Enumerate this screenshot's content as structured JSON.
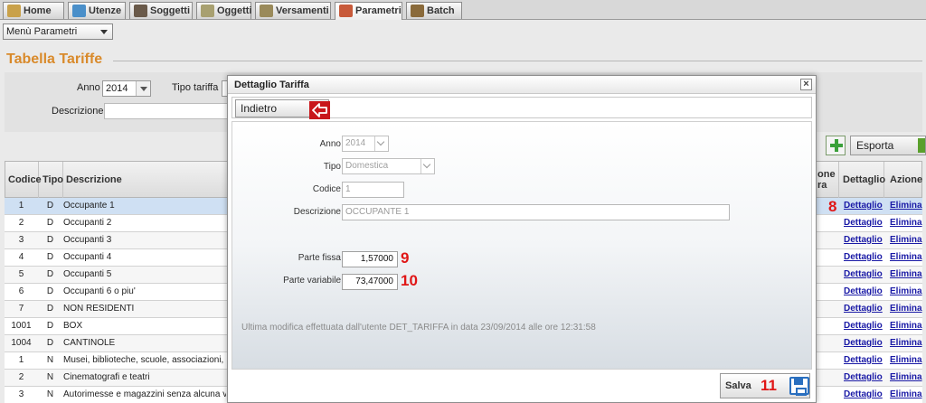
{
  "tabs": [
    {
      "label": "Home",
      "icon": "home-icon"
    },
    {
      "label": "Utenze",
      "icon": "utenze-icon"
    },
    {
      "label": "Soggetti",
      "icon": "soggetti-icon"
    },
    {
      "label": "Oggetti",
      "icon": "oggetti-icon"
    },
    {
      "label": "Versamenti",
      "icon": "versamenti-icon"
    },
    {
      "label": "Parametri",
      "icon": "parametri-icon",
      "active": true
    },
    {
      "label": "Batch",
      "icon": "batch-icon"
    }
  ],
  "menu": {
    "selected": "Menù Parametri"
  },
  "page": {
    "title": "Tabella Tariffe"
  },
  "filter": {
    "anno_label": "Anno",
    "anno_value": "2014",
    "tipo_label": "Tipo tariffa",
    "descrizione_label": "Descrizione"
  },
  "toolbar": {
    "esporta_label": "Esporta"
  },
  "table": {
    "headers": {
      "codice": "Codice",
      "tipo": "Tipo",
      "descrizione": "Descrizione",
      "partial_top": "one",
      "partial_bottom": "ra",
      "dettaglio": "Dettaglio",
      "azione": "Azione"
    },
    "rows": [
      {
        "codice": "1",
        "tipo": "D",
        "descrizione": "Occupante 1"
      },
      {
        "codice": "2",
        "tipo": "D",
        "descrizione": "Occupanti 2"
      },
      {
        "codice": "3",
        "tipo": "D",
        "descrizione": "Occupanti 3"
      },
      {
        "codice": "4",
        "tipo": "D",
        "descrizione": "Occupanti 4"
      },
      {
        "codice": "5",
        "tipo": "D",
        "descrizione": "Occupanti 5"
      },
      {
        "codice": "6",
        "tipo": "D",
        "descrizione": "Occupanti 6 o piu'"
      },
      {
        "codice": "7",
        "tipo": "D",
        "descrizione": "NON RESIDENTI"
      },
      {
        "codice": "1001",
        "tipo": "D",
        "descrizione": "BOX"
      },
      {
        "codice": "1004",
        "tipo": "D",
        "descrizione": "CANTINOLE"
      },
      {
        "codice": "1",
        "tipo": "N",
        "descrizione": "Musei, biblioteche, scuole, associazioni, luo"
      },
      {
        "codice": "2",
        "tipo": "N",
        "descrizione": "Cinematografi e teatri"
      },
      {
        "codice": "3",
        "tipo": "N",
        "descrizione": "Autorimesse e magazzini senza alcuna ven"
      }
    ],
    "dettaglio_link": "Dettaglio",
    "elimina_link": "Elimina"
  },
  "annotations": {
    "row_badge": "8",
    "fissa_badge": "9",
    "variabile_badge": "10",
    "salva_badge": "11"
  },
  "modal": {
    "title": "Dettaglio Tariffa",
    "close": "×",
    "back_label": "Indietro",
    "anno_label": "Anno",
    "anno_value": "2014",
    "tipo_label": "Tipo",
    "tipo_value": "Domestica",
    "codice_label": "Codice",
    "codice_value": "1",
    "descrizione_label": "Descrizione",
    "descrizione_value": "OCCUPANTE 1",
    "parte_fissa_label": "Parte fissa",
    "parte_fissa_value": "1,57000",
    "parte_variabile_label": "Parte variabile",
    "parte_variabile_value": "73,47000",
    "note": "Ultima modifica effettuata dall'utente DET_TARIFFA in data 23/09/2014 alle ore 12:31:58",
    "save_label": "Salva"
  },
  "colors": {
    "accent_title": "#d98a2b",
    "badge": "#e01616",
    "link": "#1a1aa6",
    "back_icon": "#c8171b",
    "save_icon": "#2a6fbf"
  }
}
